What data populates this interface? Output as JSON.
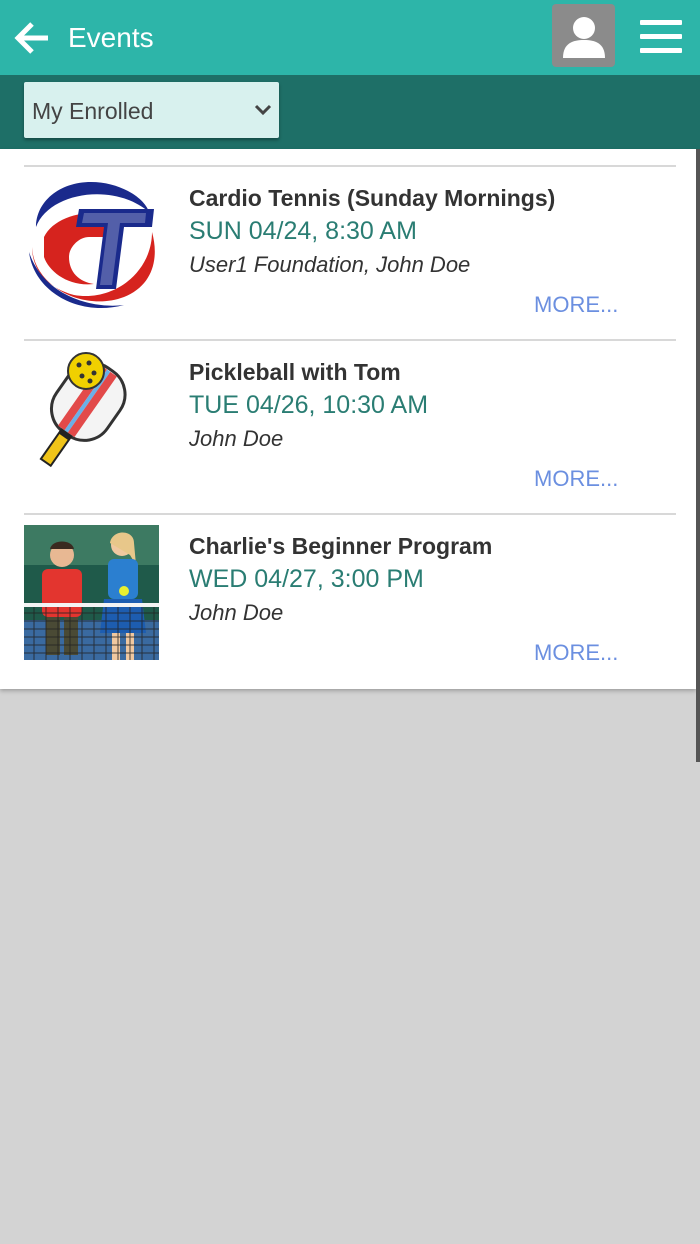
{
  "header": {
    "title": "Events",
    "back_icon": "arrow-left-icon",
    "profile_icon": "person-icon",
    "menu_icon": "hamburger-menu-icon"
  },
  "filter": {
    "selected": "My Enrolled",
    "chevron_icon": "chevron-down-icon"
  },
  "events": [
    {
      "title": "Cardio Tennis (Sunday Mornings)",
      "date": "SUN 04/24, 8:30 AM",
      "people": "User1 Foundation, John Doe",
      "more": "MORE...",
      "image": "cardio-tennis-logo"
    },
    {
      "title": "Pickleball with Tom",
      "date": "TUE 04/26, 10:30 AM",
      "people": "John Doe",
      "more": "MORE...",
      "image": "pickleball-paddle-icon"
    },
    {
      "title": "Charlie's Beginner Program",
      "date": "WED 04/27, 3:00 PM",
      "people": "John Doe",
      "more": "MORE...",
      "image": "kids-tennis-photo"
    }
  ],
  "colors": {
    "header": "#2db5a9",
    "filter_bar": "#1e6f67",
    "date_text": "#2a7d73",
    "more_link": "#6b8fe0",
    "background": "#d3d3d3"
  }
}
